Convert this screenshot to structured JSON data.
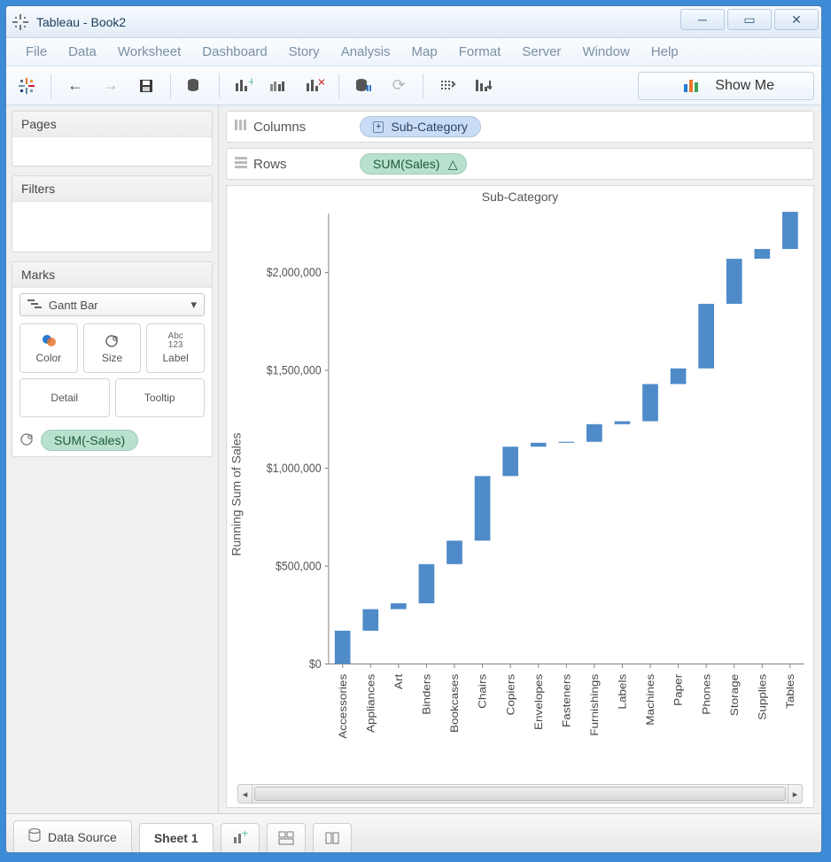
{
  "window": {
    "title": "Tableau - Book2"
  },
  "menu": [
    "File",
    "Data",
    "Worksheet",
    "Dashboard",
    "Story",
    "Analysis",
    "Map",
    "Format",
    "Server",
    "Window",
    "Help"
  ],
  "toolbar": {
    "show_me": "Show Me"
  },
  "side": {
    "pages": "Pages",
    "filters": "Filters",
    "marks": "Marks",
    "mark_type": "Gantt Bar",
    "cells": {
      "color": "Color",
      "size": "Size",
      "label": "Label",
      "detail": "Detail",
      "tooltip": "Tooltip"
    },
    "size_pill": "SUM(-Sales)"
  },
  "shelves": {
    "columns_label": "Columns",
    "columns_pill": "Sub-Category",
    "rows_label": "Rows",
    "rows_pill": "SUM(Sales)"
  },
  "chart": {
    "title": "Sub-Category",
    "ylabel": "Running Sum of Sales"
  },
  "bottom": {
    "data_source": "Data Source",
    "sheet": "Sheet 1"
  },
  "chart_data": {
    "type": "bar",
    "title": "Sub-Category",
    "xlabel": "Sub-Category",
    "ylabel": "Running Sum of Sales",
    "ylim": [
      0,
      2300000
    ],
    "y_ticks": [
      0,
      500000,
      1000000,
      1500000,
      2000000
    ],
    "y_tick_labels": [
      "$0",
      "$500,000",
      "$1,000,000",
      "$1,500,000",
      "$2,000,000"
    ],
    "categories": [
      "Accessories",
      "Appliances",
      "Art",
      "Binders",
      "Bookcases",
      "Chairs",
      "Copiers",
      "Envelopes",
      "Fasteners",
      "Furnishings",
      "Labels",
      "Machines",
      "Paper",
      "Phones",
      "Storage",
      "Supplies",
      "Tables"
    ],
    "running_start": [
      0,
      170000,
      280000,
      310000,
      510000,
      630000,
      960000,
      1110000,
      1130000,
      1135000,
      1225000,
      1240000,
      1430000,
      1510000,
      1840000,
      2070000,
      2120000
    ],
    "running_end": [
      170000,
      280000,
      310000,
      510000,
      630000,
      960000,
      1110000,
      1130000,
      1135000,
      1225000,
      1240000,
      1430000,
      1510000,
      1840000,
      2070000,
      2120000,
      2310000
    ]
  }
}
